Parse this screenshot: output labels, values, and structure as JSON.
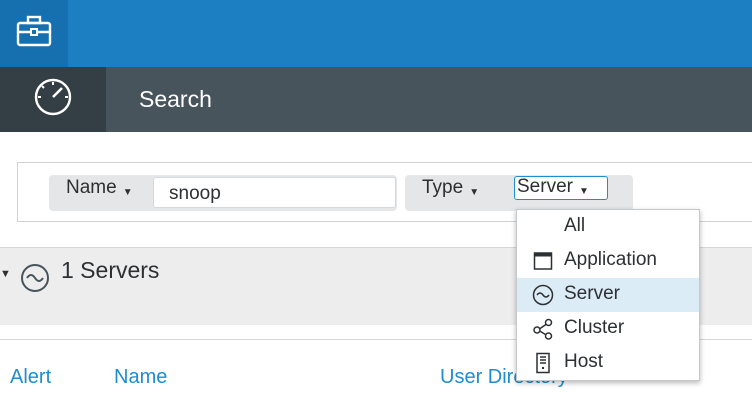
{
  "topbar": {
    "logo_icon": "toolbox-icon"
  },
  "nav": {
    "icon": "dashboard-gauge-icon",
    "title": "Search"
  },
  "filters": {
    "name": {
      "label": "Name",
      "value": "snoop"
    },
    "type": {
      "label": "Type",
      "value": "Server"
    }
  },
  "results": {
    "title": "1 Servers",
    "icon": "server-icon"
  },
  "columns": {
    "alert": "Alert",
    "name": "Name",
    "user_directory": "User Directory"
  },
  "dropdown": {
    "items": [
      {
        "label": "All",
        "icon": ""
      },
      {
        "label": "Application",
        "icon": "application-window-icon"
      },
      {
        "label": "Server",
        "icon": "server-icon",
        "selected": true
      },
      {
        "label": "Cluster",
        "icon": "cluster-icon"
      },
      {
        "label": "Host",
        "icon": "host-icon"
      }
    ]
  },
  "colors": {
    "topbar": "#1b7fc1",
    "navbar": "#47545c",
    "accent": "#1e8dd2",
    "selected": "#dcecf7"
  }
}
